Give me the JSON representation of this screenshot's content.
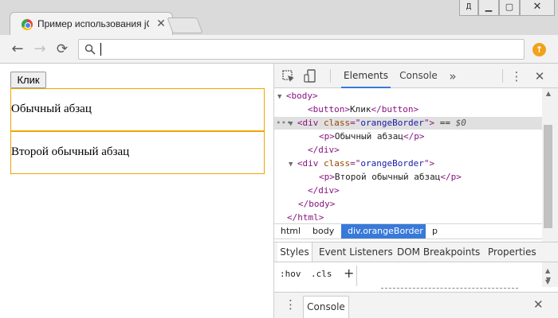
{
  "window": {
    "user_button": "Д",
    "minimize_glyph": "▁",
    "maximize_glyph": "▢",
    "close_glyph": "✕"
  },
  "tab": {
    "title": "Пример использования jQuery",
    "close_glyph": "✕",
    "favicon": "chrome-favicon-icon"
  },
  "toolbar": {
    "back_glyph": "←",
    "forward_glyph": "→",
    "reload_glyph": "⟳",
    "address_value": "",
    "extension_glyph": "↑"
  },
  "page": {
    "button_label": "Клик",
    "paragraphs": [
      "Обычный абзац",
      "Второй обычный абзац"
    ],
    "border_color": "#f0a500"
  },
  "devtools": {
    "tabs": {
      "elements": "Elements",
      "console": "Console",
      "more": "»"
    },
    "dom_lines": [
      {
        "pre": "▼",
        "parts": [
          [
            "tag",
            "<body>"
          ]
        ]
      },
      {
        "pre": "",
        "parts": [
          [
            "tag",
            "<button>"
          ],
          [
            "txt",
            "Клик"
          ],
          [
            "tag",
            "</button>"
          ]
        ]
      },
      {
        "pre": "▼",
        "parts": [
          [
            "tag",
            "<div "
          ],
          [
            "attr",
            "class"
          ],
          [
            "tag",
            "=\""
          ],
          [
            "val",
            "orangeBorder"
          ],
          [
            "tag",
            "\">"
          ],
          [
            "eqref",
            " == "
          ],
          [
            "dollar",
            "$0"
          ]
        ]
      },
      {
        "pre": "",
        "parts": [
          [
            "tag",
            "<p>"
          ],
          [
            "txt",
            "Обычный абзац"
          ],
          [
            "tag",
            "</p>"
          ]
        ]
      },
      {
        "pre": "",
        "parts": [
          [
            "tag",
            "</div>"
          ]
        ]
      },
      {
        "pre": "▼",
        "parts": [
          [
            "tag",
            "<div "
          ],
          [
            "attr",
            "class"
          ],
          [
            "tag",
            "=\""
          ],
          [
            "val",
            "orangeBorder"
          ],
          [
            "tag",
            "\">"
          ]
        ]
      },
      {
        "pre": "",
        "parts": [
          [
            "tag",
            "<p>"
          ],
          [
            "txt",
            "Второй обычный абзац"
          ],
          [
            "tag",
            "</p>"
          ]
        ]
      },
      {
        "pre": "",
        "parts": [
          [
            "tag",
            "</div>"
          ]
        ]
      },
      {
        "pre": "",
        "parts": [
          [
            "tag",
            "</body>"
          ]
        ]
      },
      {
        "pre": "",
        "parts": [
          [
            "tag",
            "</html>"
          ]
        ]
      }
    ],
    "selected_dots": "•••",
    "breadcrumbs": [
      "html",
      "body",
      "div.orangeBorder",
      "p"
    ],
    "styles_tabs": [
      "Styles",
      "Event Listeners",
      "DOM Breakpoints",
      "Properties"
    ],
    "filter": {
      "hov": ":hov",
      "cls": ".cls",
      "plus": "+"
    },
    "drawer": {
      "tab": "Console",
      "close_glyph": "✕"
    },
    "accent_color": "#3879d9"
  }
}
